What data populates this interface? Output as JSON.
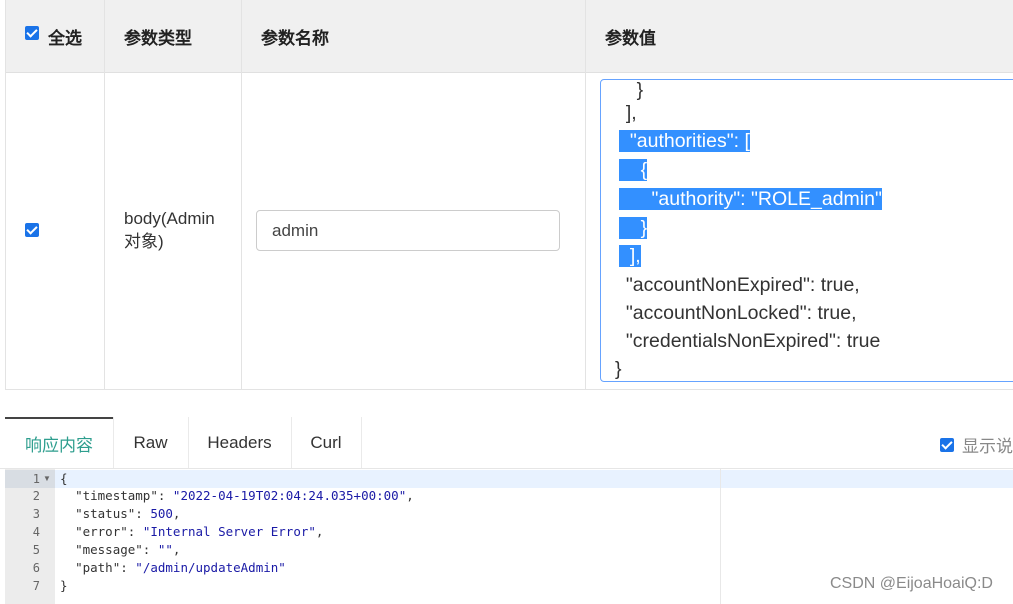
{
  "table": {
    "headers": {
      "select_all": "全选",
      "param_type": "参数类型",
      "param_name": "参数名称",
      "param_value": "参数值"
    },
    "row": {
      "checked": true,
      "type_line1": "body(Admin",
      "type_line2": "对象)",
      "name_value": "admin",
      "value_lines": [
        "    }",
        "  ],",
        "  \"authorities\": [",
        "    {",
        "      \"authority\": \"ROLE_admin\"",
        "    }",
        "  ],",
        "  \"accountNonExpired\": true,",
        "  \"accountNonLocked\": true,",
        "  \"credentialsNonExpired\": true",
        "}"
      ]
    }
  },
  "response": {
    "tabs": [
      "响应内容",
      "Raw",
      "Headers",
      "Curl"
    ],
    "active_tab": "响应内容",
    "show_desc_label": "显示说",
    "show_desc_checked": true,
    "line_numbers": [
      "1",
      "2",
      "3",
      "4",
      "5",
      "6",
      "7"
    ],
    "json": {
      "timestamp": "2022-04-19T02:04:24.035+00:00",
      "status": "500",
      "error": "Internal Server Error",
      "message": "",
      "path": "/admin/updateAdmin"
    }
  },
  "watermark": "CSDN @EijoaHoaiQ:D",
  "colors": {
    "selection": "#3390ff",
    "active_tab": "#2e9e8e",
    "checkbox": "#1a73e8",
    "focus_border": "#66a3ff"
  }
}
